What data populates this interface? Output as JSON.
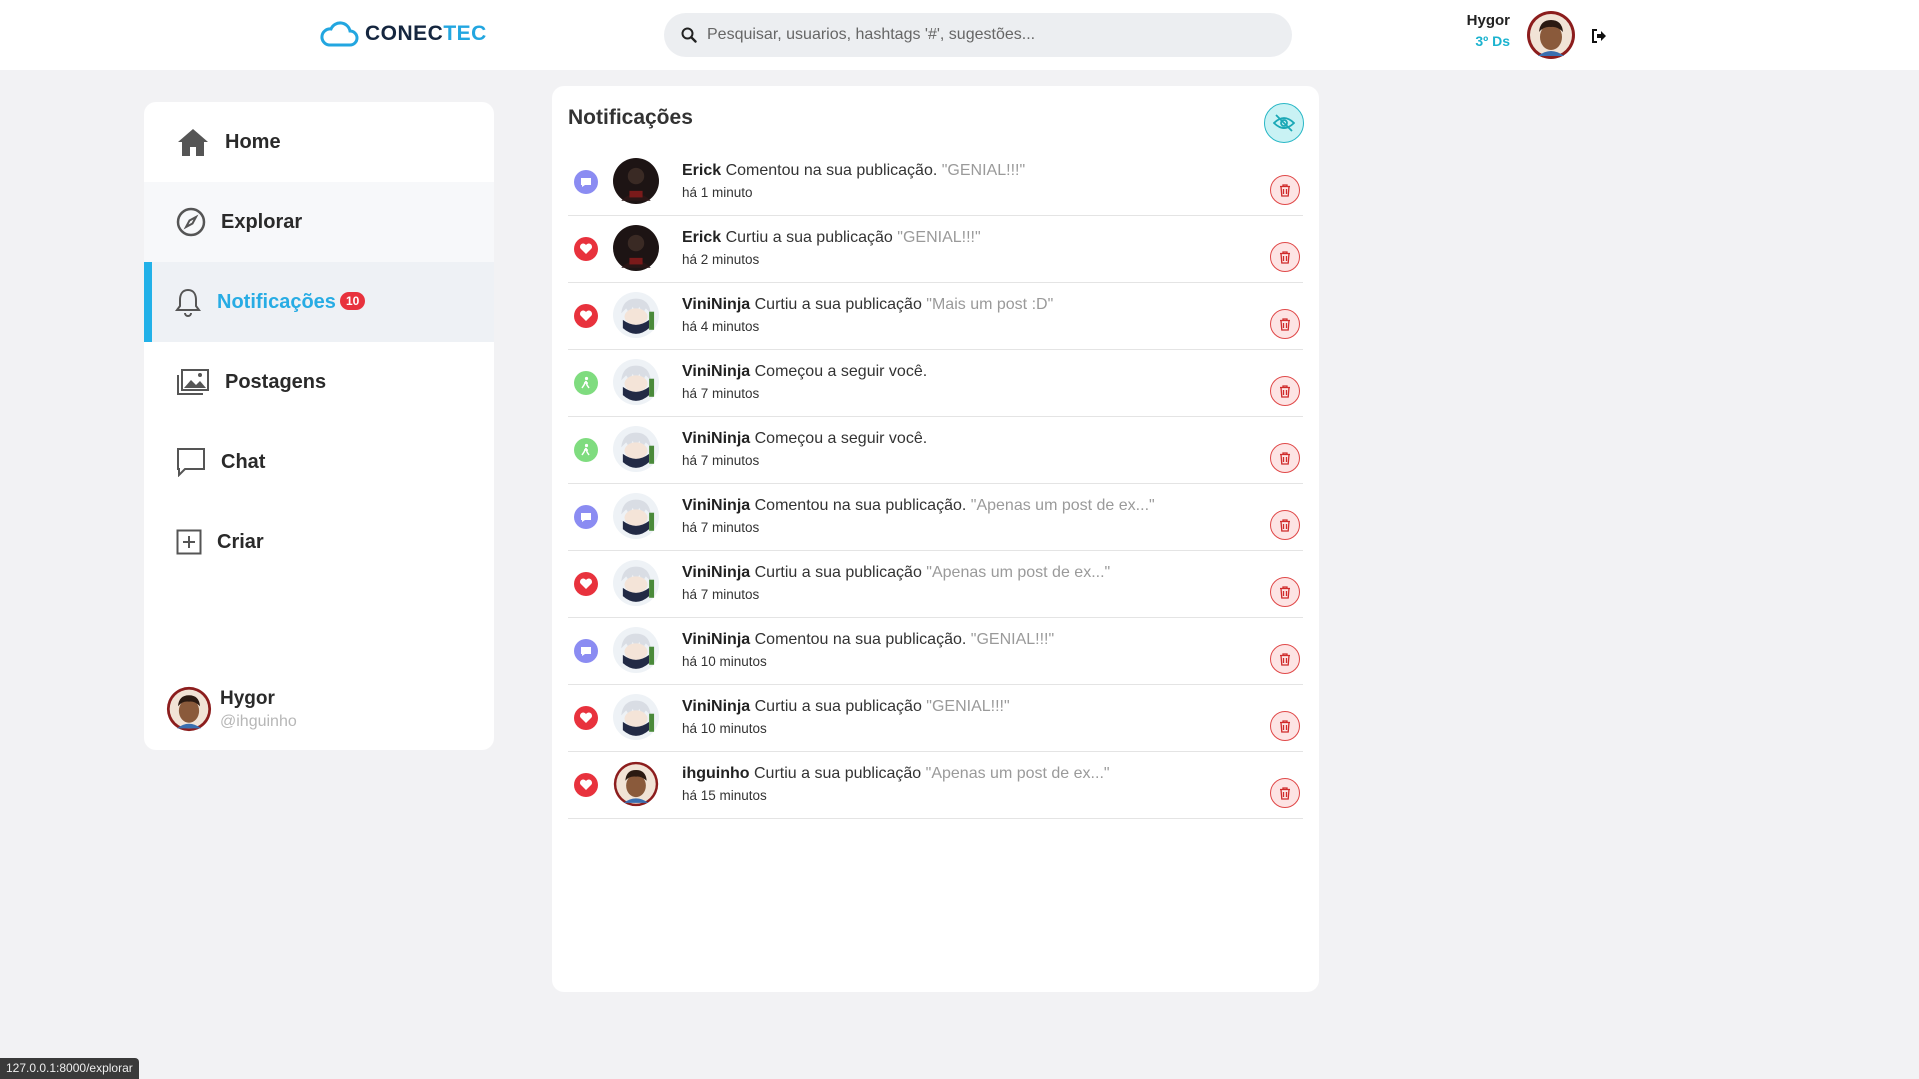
{
  "header": {
    "logo_part1": "CONEC",
    "logo_part2": "TEC",
    "search_placeholder": "Pesquisar, usuarios, hashtags '#', sugestões...",
    "user_name": "Hygor",
    "user_class": "3º Ds"
  },
  "sidebar": {
    "items": [
      {
        "label": "Home",
        "icon": "home-icon"
      },
      {
        "label": "Explorar",
        "icon": "compass-icon"
      },
      {
        "label": "Notificações",
        "icon": "bell-icon",
        "badge": "10",
        "active": true
      },
      {
        "label": "Postagens",
        "icon": "images-icon"
      },
      {
        "label": "Chat",
        "icon": "chat-icon"
      },
      {
        "label": "Criar",
        "icon": "plus-square-icon"
      }
    ],
    "user": {
      "name": "Hygor",
      "handle": "@ihguinho"
    }
  },
  "notifications": {
    "title": "Notificações",
    "items": [
      {
        "type": "comment",
        "user": "Erick",
        "action": "Comentou na sua publicação.",
        "quote": "\"GENIAL!!!\"",
        "time": "há 1 minuto",
        "avatar": "erick"
      },
      {
        "type": "like",
        "user": "Erick",
        "action": "Curtiu a sua publicação",
        "quote": "\"GENIAL!!!\"",
        "time": "há 2 minutos",
        "avatar": "erick"
      },
      {
        "type": "like",
        "user": "ViniNinja",
        "action": "Curtiu a sua publicação",
        "quote": "\"Mais um post :D\"",
        "time": "há 4 minutos",
        "avatar": "ninja"
      },
      {
        "type": "follow",
        "user": "ViniNinja",
        "action": "Começou a seguir você.",
        "quote": "",
        "time": "há 7 minutos",
        "avatar": "ninja"
      },
      {
        "type": "follow",
        "user": "ViniNinja",
        "action": "Começou a seguir você.",
        "quote": "",
        "time": "há 7 minutos",
        "avatar": "ninja"
      },
      {
        "type": "comment",
        "user": "ViniNinja",
        "action": "Comentou na sua publicação.",
        "quote": "\"Apenas um post de ex...\"",
        "time": "há 7 minutos",
        "avatar": "ninja"
      },
      {
        "type": "like",
        "user": "ViniNinja",
        "action": "Curtiu a sua publicação",
        "quote": "\"Apenas um post de ex...\"",
        "time": "há 7 minutos",
        "avatar": "ninja"
      },
      {
        "type": "comment",
        "user": "ViniNinja",
        "action": "Comentou na sua publicação.",
        "quote": "\"GENIAL!!!\"",
        "time": "há 10 minutos",
        "avatar": "ninja"
      },
      {
        "type": "like",
        "user": "ViniNinja",
        "action": "Curtiu a sua publicação",
        "quote": "\"GENIAL!!!\"",
        "time": "há 10 minutos",
        "avatar": "ninja"
      },
      {
        "type": "like",
        "user": "ihguinho",
        "action": "Curtiu a sua publicação",
        "quote": "\"Apenas um post de ex...\"",
        "time": "há 15 minutos",
        "avatar": "hygor"
      }
    ]
  },
  "statusbar": {
    "url": "127.0.0.1:8000/explorar"
  },
  "colors": {
    "accent": "#22b1e8",
    "badge": "#e8323d",
    "like": "#e8323d",
    "comment": "#8b8cf2",
    "follow": "#7fdc7f"
  }
}
